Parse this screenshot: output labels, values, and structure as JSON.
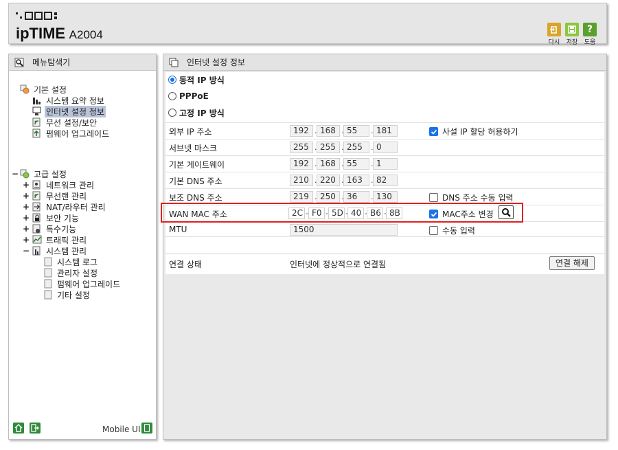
{
  "header": {
    "brand": "ipTIME",
    "model": "A2004",
    "buttons": [
      {
        "label": "다시",
        "icon": "undo-icon",
        "color": "#d9a42c"
      },
      {
        "label": "저장",
        "icon": "save-icon",
        "color": "#8cc63f"
      },
      {
        "label": "도움",
        "icon": "help-icon",
        "color": "#5aa02c"
      }
    ]
  },
  "sidebar": {
    "title": "메뉴탐색기",
    "basic": {
      "label": "기본 설정",
      "items": [
        "시스템 요약 정보",
        "인터넷 설정 정보",
        "무선 설정/보안",
        "펌웨어 업그레이드"
      ],
      "selected_index": 1
    },
    "advanced": {
      "label": "고급 설정",
      "items": [
        "네트워크 관리",
        "무선랜 관리",
        "NAT/라우터 관리",
        "보안 기능",
        "특수기능",
        "트래픽 관리",
        "시스템 관리"
      ],
      "system_sub": [
        "시스템 로그",
        "관리자 설정",
        "펌웨어 업그레이드",
        "기타 설정"
      ]
    },
    "mobile_label": "Mobile UI"
  },
  "main": {
    "title": "인터넷 설정 정보",
    "modes": [
      {
        "label": "동적 IP 방식",
        "selected": true
      },
      {
        "label": "PPPoE",
        "selected": false
      },
      {
        "label": "고정 IP 방식",
        "selected": false
      }
    ],
    "rows": {
      "external_ip": {
        "label": "외부 IP 주소",
        "octets": [
          "192",
          "168",
          "55",
          "181"
        ]
      },
      "subnet": {
        "label": "서브넷 마스크",
        "octets": [
          "255",
          "255",
          "255",
          "0"
        ]
      },
      "gateway": {
        "label": "기본 게이트웨이",
        "octets": [
          "192",
          "168",
          "55",
          "1"
        ]
      },
      "dns1": {
        "label": "기본 DNS 주소",
        "octets": [
          "210",
          "220",
          "163",
          "82"
        ]
      },
      "dns2": {
        "label": "보조 DNS 주소",
        "octets": [
          "219",
          "250",
          "36",
          "130"
        ]
      },
      "mac": {
        "label": "WAN MAC 주소",
        "parts": [
          "2C",
          "F0",
          "5D",
          "40",
          "B6",
          "8B"
        ]
      },
      "mtu": {
        "label": "MTU",
        "value": "1500"
      }
    },
    "options": {
      "private_ip": {
        "label": "사설 IP 할당 허용하기",
        "checked": true
      },
      "dns_manual": {
        "label": "DNS 주소 수동 입력",
        "checked": false
      },
      "mac_change": {
        "label": "MAC주소 변경",
        "checked": true
      },
      "mtu_manual": {
        "label": "수동 입력",
        "checked": false
      }
    },
    "connection": {
      "label": "연결 상태",
      "status": "인터넷에 정상적으로 연결됨",
      "button": "연결 해제"
    },
    "highlight_color": "#e02020"
  }
}
